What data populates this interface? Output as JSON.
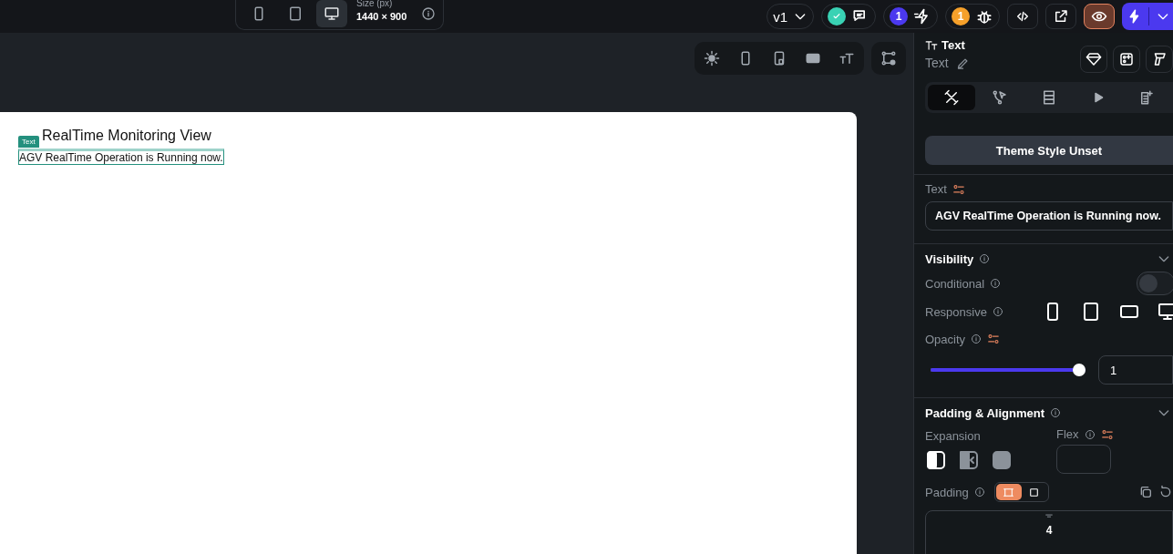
{
  "top_bar": {
    "devices": [
      {
        "kind": "phone",
        "selected": false
      },
      {
        "kind": "tablet",
        "selected": false
      },
      {
        "kind": "desktop",
        "selected": true
      }
    ],
    "size_label": "Size (px)",
    "size_value": "1440 × 900",
    "version": "v1",
    "review": {
      "checked": true
    },
    "actions_count": "1",
    "issues_count": "1",
    "preview": {
      "selected": true
    }
  },
  "canvas": {
    "title": "RealTime Monitoring View",
    "selected_badge": "Text",
    "selected_text": "AGV RealTime Operation is Running now."
  },
  "panel": {
    "title": "Text",
    "name": "Text",
    "tabs": [
      {
        "kind": "design",
        "selected": true
      },
      {
        "kind": "actions",
        "selected": false
      },
      {
        "kind": "backend",
        "selected": false
      },
      {
        "kind": "animation",
        "selected": false
      },
      {
        "kind": "logs",
        "selected": false
      }
    ],
    "theme_button": "Theme Style Unset",
    "text_label": "Text",
    "text_value": "AGV RealTime Operation is Running now.",
    "visibility": {
      "title": "Visibility",
      "conditional_label": "Conditional",
      "conditional": {
        "on": false
      },
      "responsive_label": "Responsive",
      "responsive": [
        {
          "kind": "phone"
        },
        {
          "kind": "tablet"
        },
        {
          "kind": "landscape"
        },
        {
          "kind": "desktop"
        }
      ],
      "opacity_label": "Opacity",
      "opacity": {
        "level": 1
      },
      "opacity_value": "1"
    },
    "padding": {
      "title": "Padding & Alignment",
      "expansion_label": "Expansion",
      "expansion": [
        {
          "kind": "fill",
          "selected": true
        },
        {
          "kind": "shrink",
          "selected": false
        },
        {
          "kind": "full",
          "selected": false
        }
      ],
      "flex_label": "Flex",
      "padding_label": "Padding",
      "modes": [
        {
          "kind": "all",
          "selected": true
        },
        {
          "kind": "single",
          "selected": false
        }
      ],
      "top_value": "4"
    }
  }
}
